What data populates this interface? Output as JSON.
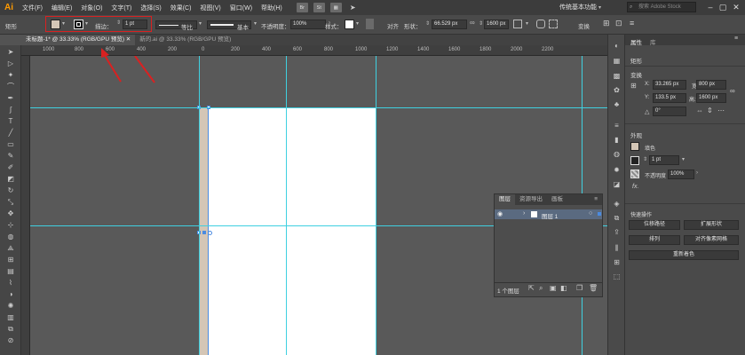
{
  "app": {
    "logo": "Ai"
  },
  "menubar": {
    "items": [
      "文件(F)",
      "编辑(E)",
      "对象(O)",
      "文字(T)",
      "选择(S)",
      "效果(C)",
      "视图(V)",
      "窗口(W)",
      "帮助(H)"
    ],
    "icons": [
      "Br",
      "St"
    ],
    "workspace": "传统基本功能",
    "search_placeholder": "搜索 Adobe Stock"
  },
  "controlbar": {
    "tool_name": "矩形",
    "stroke_label": "描边：",
    "stroke_value": "1 pt",
    "profile_label": "等比",
    "brush_label": "基本",
    "opacity_label": "不透明度：",
    "opacity_value": "100%",
    "style_label": "样式：",
    "align_label": "对齐",
    "shape_label": "形状：",
    "width_value": "66.529 px",
    "height_value": "1600 px",
    "transform_label": "变换"
  },
  "tabs": [
    {
      "label": "未标题-1* @ 33.33% (RGB/GPU 预览)",
      "active": true
    },
    {
      "label": "新的.ai @ 33.33% (RGB/GPU 预览)",
      "active": false
    }
  ],
  "ruler": {
    "labels": [
      "1000",
      "800",
      "600",
      "400",
      "200",
      "0",
      "200",
      "400",
      "600",
      "800",
      "1000",
      "1200",
      "1400",
      "1600",
      "1800",
      "2000",
      "2200"
    ]
  },
  "layers_panel": {
    "tabs": [
      "图层",
      "资源导出",
      "画板"
    ],
    "layer_name": "图层 1",
    "footer_count": "1 个图层"
  },
  "properties_panel": {
    "tabs": [
      "属性",
      "库"
    ],
    "object_type": "矩形",
    "transform_title": "变换",
    "x_label": "X:",
    "x_value": "33.265 px",
    "y_label": "Y:",
    "y_value": "133.5 px",
    "w_label": "宽:",
    "w_value": "800 px",
    "h_label": "高:",
    "h_value": "1600 px",
    "angle_value": "0°",
    "appearance_title": "外观",
    "fill_label": "填色",
    "stroke_value": "1 pt",
    "opacity_label": "不透明度",
    "opacity_value": "100%",
    "fx_label": "fx.",
    "quick_actions_title": "快速操作",
    "btn_offset_path": "位移路径",
    "btn_expand_shape": "扩展形状",
    "btn_arrange": "排列",
    "btn_align_pixel": "对齐像素网格",
    "btn_recolor": "重新着色"
  },
  "colors": {
    "accent_red": "#d92121",
    "guide": "#3fd0e0",
    "fill_swatch": "#d4c6b6",
    "selection_blue": "#4b8be0",
    "brand": "#ff9a00"
  }
}
